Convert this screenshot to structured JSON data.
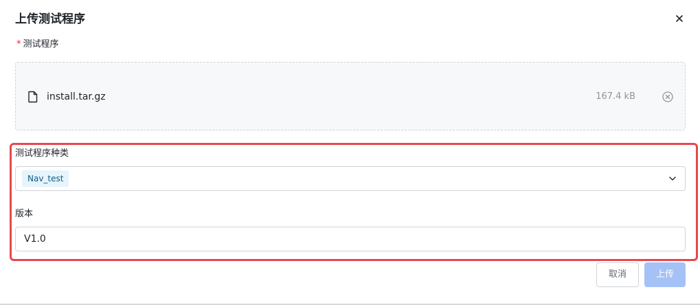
{
  "dialog": {
    "title": "上传测试程序",
    "close_icon": "close-icon"
  },
  "program_field": {
    "required_mark": "*",
    "label": "测试程序",
    "file": {
      "icon": "file-icon",
      "name": "install.tar.gz",
      "size": "167.4 kB",
      "remove_icon": "circle-x-icon"
    }
  },
  "type_field": {
    "label": "测试程序种类",
    "selected_tag": "Nav_test",
    "dropdown_icon": "chevron-down-icon"
  },
  "version_field": {
    "label": "版本",
    "value": "V1.0"
  },
  "footer": {
    "cancel_label": "取消",
    "upload_label": "上传"
  },
  "colors": {
    "highlight_border": "#e5484d",
    "primary_disabled": "#a5c2f6",
    "tag_bg": "#e6f4fb",
    "tag_text": "#0f5c86",
    "required": "#f5222d"
  }
}
